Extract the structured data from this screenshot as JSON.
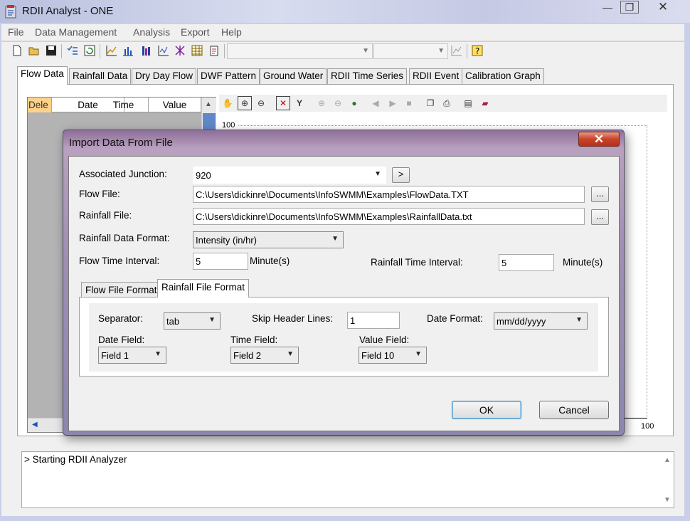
{
  "window": {
    "title": "RDII Analyst - ONE",
    "minimize_glyph": "—",
    "maximize_glyph": "❐",
    "close_glyph": "✕"
  },
  "menu": [
    "File",
    "Data Management",
    "Analysis",
    "Export",
    "Help"
  ],
  "toolbar": {
    "combo1_value": "",
    "combo2_value": "",
    "icons": [
      "new-icon",
      "open-icon",
      "save-icon",
      "checklist-icon",
      "refresh-icon",
      "line-chart-icon",
      "bar-chart-icon",
      "histogram-icon",
      "scatter-icon",
      "event-icon",
      "table-icon",
      "settings-icon",
      "graph-icon",
      "help-icon"
    ]
  },
  "main_tabs": [
    "Flow Data",
    "Rainfall Data",
    "Dry Day Flow",
    "DWF Pattern",
    "Ground Water",
    "RDII Time Series",
    "RDII Event",
    "Calibration Graph"
  ],
  "active_main_tab": "Flow Data",
  "grid": {
    "columns": [
      "Dele",
      "Date",
      "Time",
      "Value"
    ]
  },
  "chart": {
    "y_max_label": "100",
    "x_max_label": "100",
    "toolbar_icons": [
      "hand-icon",
      "zoom-in-icon",
      "zoom-out-icon",
      "reset-icon",
      "y-axis-icon",
      "zoom-plus-icon",
      "zoom-minus-icon",
      "globe-icon",
      "prev-icon",
      "next-icon",
      "stop-icon",
      "copy-icon",
      "print-icon",
      "properties-icon",
      "book-icon"
    ]
  },
  "log": {
    "lines": [
      "> Starting RDII Analyzer"
    ]
  },
  "dialog": {
    "title": "Import Data From File",
    "close_glyph": "✕",
    "associated_junction_label": "Associated Junction:",
    "associated_junction_value": "920",
    "go_button": ">",
    "flow_file_label": "Flow File:",
    "flow_file_value": "C:\\Users\\dickinre\\Documents\\InfoSWMM\\Examples\\FlowData.TXT",
    "rainfall_file_label": "Rainfall File:",
    "rainfall_file_value": "C:\\Users\\dickinre\\Documents\\InfoSWMM\\Examples\\RainfallData.txt",
    "browse_label": "...",
    "rainfall_format_label": "Rainfall Data Format:",
    "rainfall_format_value": "Intensity (in/hr)",
    "flow_interval_label": "Flow Time Interval:",
    "flow_interval_value": "5",
    "flow_interval_unit": "Minute(s)",
    "rainfall_interval_label": "Rainfall Time Interval:",
    "rainfall_interval_value": "5",
    "rainfall_interval_unit": "Minute(s)",
    "sub_tabs": [
      "Flow File Format",
      "Rainfall File Format"
    ],
    "active_sub_tab": "Rainfall File Format",
    "format": {
      "separator_label": "Separator:",
      "separator_value": "tab",
      "skip_header_label": "Skip Header Lines:",
      "skip_header_value": "1",
      "date_format_label": "Date Format:",
      "date_format_value": "mm/dd/yyyy",
      "date_field_label": "Date Field:",
      "date_field_value": "Field 1",
      "time_field_label": "Time Field:",
      "time_field_value": "Field 2",
      "value_field_label": "Value Field:",
      "value_field_value": "Field 10"
    },
    "ok_label": "OK",
    "cancel_label": "Cancel"
  }
}
